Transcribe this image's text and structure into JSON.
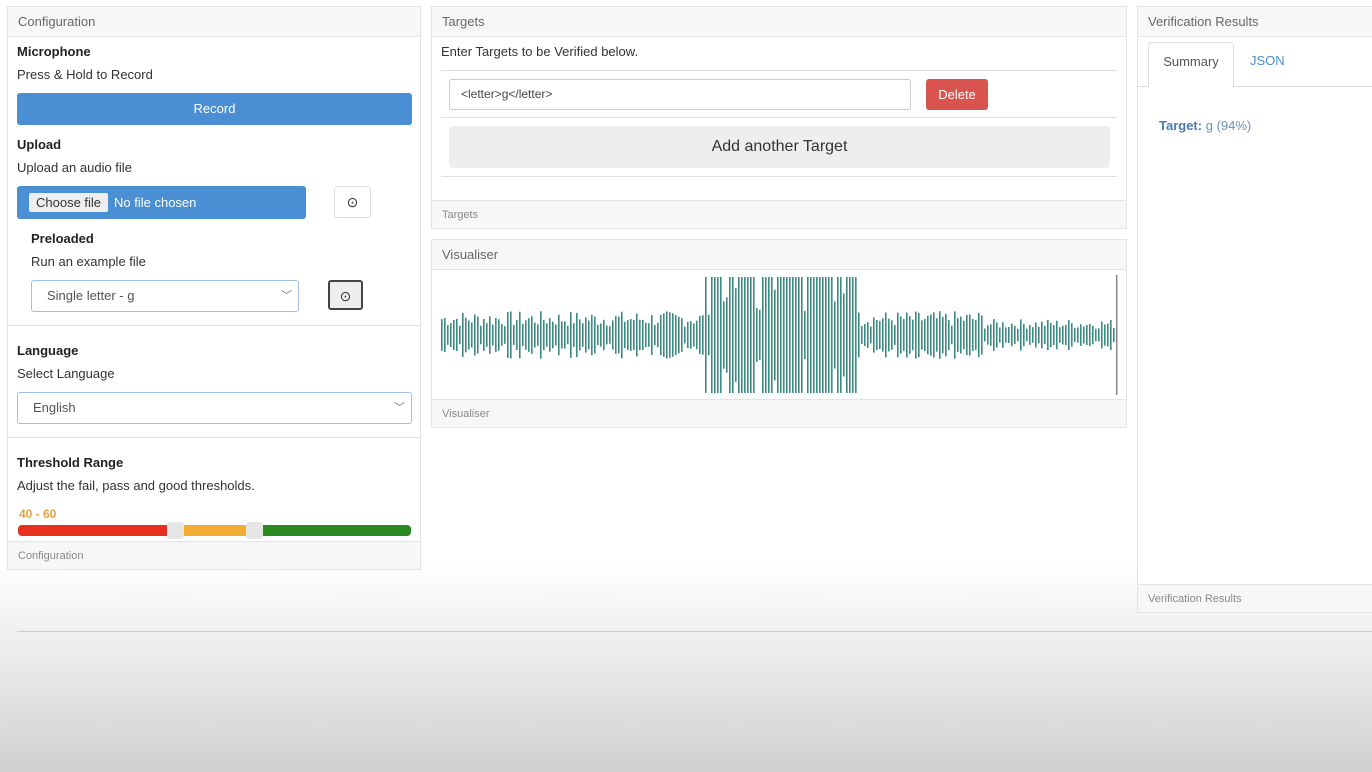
{
  "config": {
    "title": "Configuration",
    "footer": "Configuration",
    "microphone": {
      "heading": "Microphone",
      "hint": "Press & Hold to Record",
      "record": "Record"
    },
    "upload": {
      "heading": "Upload",
      "hint": "Upload an audio file",
      "choose": "Choose file",
      "no_file": "No file chosen"
    },
    "preloaded": {
      "heading": "Preloaded",
      "hint": "Run an example file",
      "selected": "Single letter - g"
    },
    "language": {
      "heading": "Language",
      "hint": "Select Language",
      "selected": "English"
    },
    "threshold": {
      "heading": "Threshold Range",
      "hint": "Adjust the fail, pass and good thresholds.",
      "label": "40 - 60",
      "low": 40,
      "high": 60,
      "colors": {
        "fail": "#e8301f",
        "pass": "#f3ac34",
        "good": "#2a8a1f"
      }
    }
  },
  "targets": {
    "title": "Targets",
    "footer": "Targets",
    "hint": "Enter Targets to be Verified below.",
    "items": [
      {
        "value": "<letter>g</letter>"
      }
    ],
    "delete": "Delete",
    "add": "Add another Target"
  },
  "visualiser": {
    "title": "Visualiser",
    "footer": "Visualiser",
    "color": "#3d8a83"
  },
  "results": {
    "title": "Verification Results",
    "footer": "Verification Results",
    "tabs": [
      "Summary",
      "JSON"
    ],
    "target_label": "Target:",
    "target_value": "g (94%)"
  }
}
